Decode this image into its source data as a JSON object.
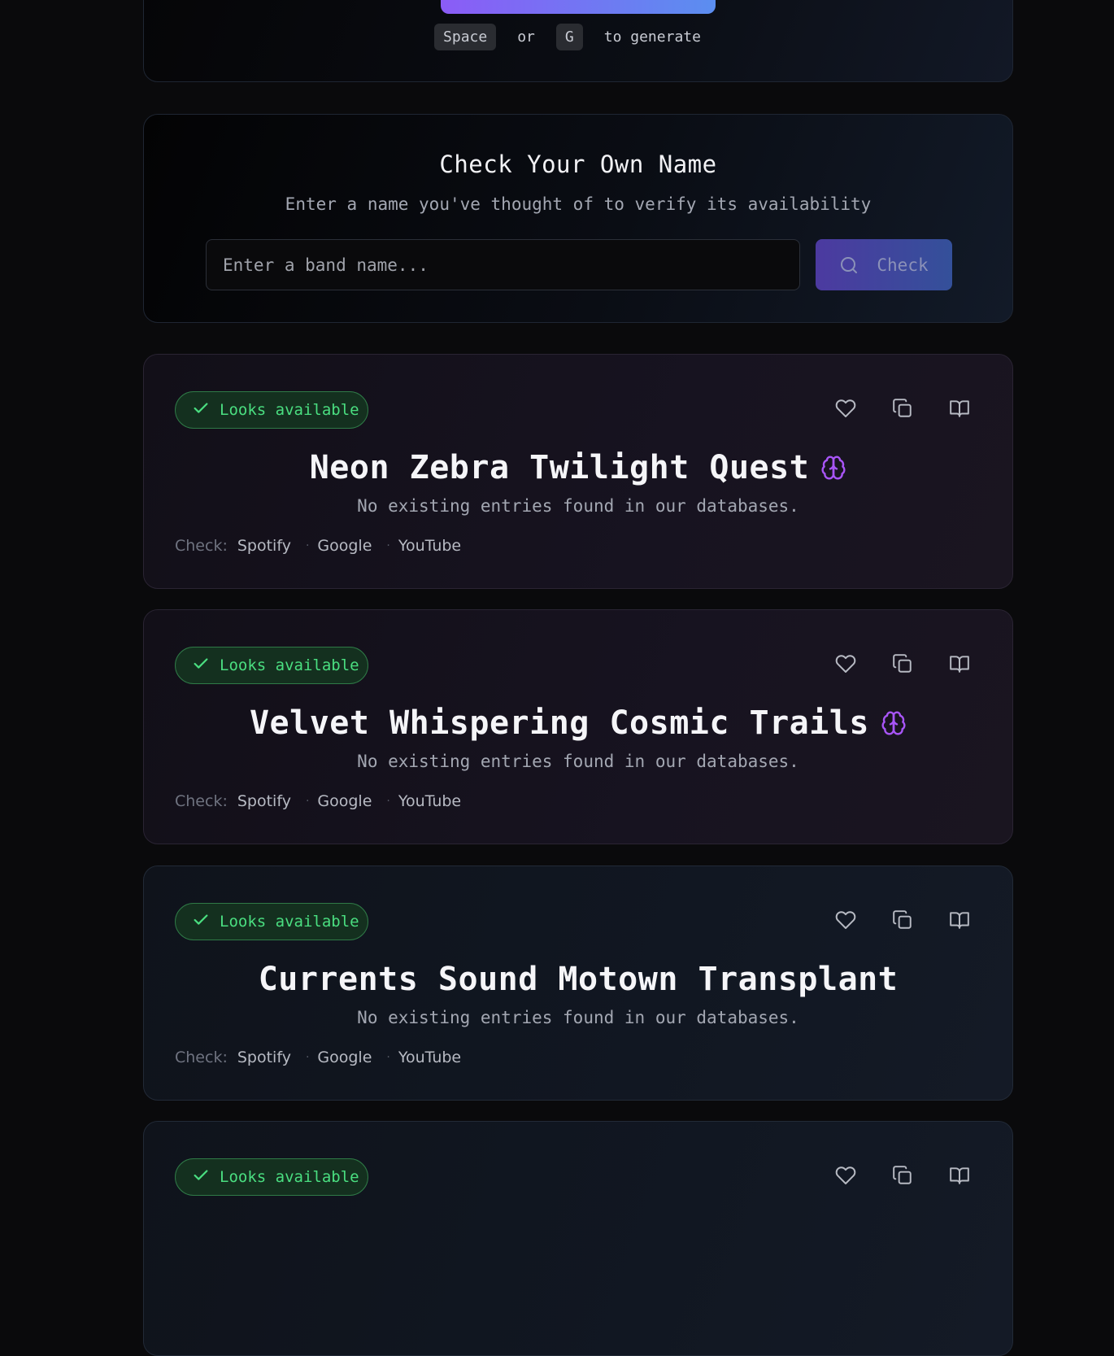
{
  "generator": {
    "hint_key_1": "Space",
    "hint_or": "or",
    "hint_key_2": "G",
    "hint_suffix": "to generate"
  },
  "check_section": {
    "title": "Check Your Own Name",
    "subtitle": "Enter a name you've thought of to verify its availability",
    "input_placeholder": "Enter a band name...",
    "input_value": "",
    "button_label": "Check"
  },
  "results": [
    {
      "status": "Looks available",
      "name": "Neon Zebra Twilight Quest",
      "ai_generated": true,
      "note": "No existing entries found in our databases.",
      "check_label": "Check:",
      "links": [
        "Spotify",
        "Google",
        "YouTube"
      ]
    },
    {
      "status": "Looks available",
      "name": "Velvet Whispering Cosmic Trails",
      "ai_generated": true,
      "note": "No existing entries found in our databases.",
      "check_label": "Check:",
      "links": [
        "Spotify",
        "Google",
        "YouTube"
      ]
    },
    {
      "status": "Looks available",
      "name": "Currents Sound Motown Transplant",
      "ai_generated": false,
      "note": "No existing entries found in our databases.",
      "check_label": "Check:",
      "links": [
        "Spotify",
        "Google",
        "YouTube"
      ]
    },
    {
      "status": "Looks available",
      "name": "",
      "ai_generated": false,
      "note": "",
      "check_label": "",
      "links": []
    }
  ],
  "icons": {
    "status": "check-icon",
    "ai": "brain-icon",
    "favorite": "heart-icon",
    "copy": "copy-icon",
    "lookup": "book-icon",
    "search": "search-icon"
  },
  "colors": {
    "accent_gradient_start": "#8b5cf6",
    "accent_gradient_end": "#5b8ef0",
    "available_green": "#4ade80",
    "brain_purple": "#a855f7",
    "background": "#0a0a0c"
  }
}
